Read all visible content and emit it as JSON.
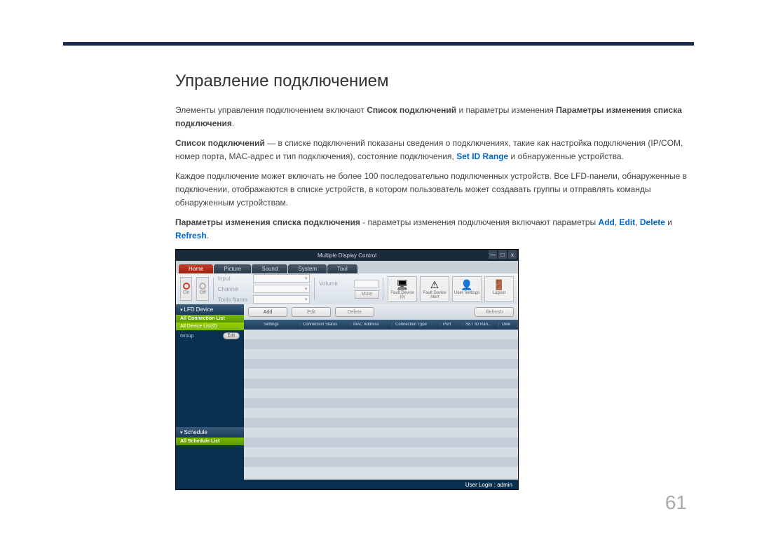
{
  "heading": "Управление подключением",
  "para1": {
    "t1": "Элементы управления подключением включают ",
    "b1": "Список подключений",
    "t2": " и параметры изменения ",
    "b2": "Параметры изменения списка подключения",
    "t3": "."
  },
  "para2": {
    "b1": "Список подключений",
    "t1": " — в списке подключений показаны сведения о подключениях, такие как настройка подключения (IP/COM, номер порта, MAC-адрес и тип подключения), состояние подключения, ",
    "blue1": "Set ID Range",
    "t2": " и обнаруженные устройства."
  },
  "para3": "Каждое подключение может включать не более 100 последовательно подключенных устройств. Все LFD-панели, обнаруженные в подключении, отображаются в списке устройств, в котором пользователь может создавать группы и отправлять команды обнаруженным устройствам.",
  "para4": {
    "b1": "Параметры изменения списка подключения",
    "t1": " - параметры изменения подключения включают параметры ",
    "a1": "Add",
    "c1": ", ",
    "a2": "Edit",
    "c2": ", ",
    "a3": "Delete",
    "c3": " и ",
    "a4": "Refresh",
    "t2": "."
  },
  "app": {
    "title": "Multiple Display Control",
    "titlebar_minimize": "—",
    "titlebar_maximize": "□",
    "titlebar_close": "x",
    "tabs": [
      "Home",
      "Picture",
      "Sound",
      "System",
      "Tool"
    ],
    "power_on": "On",
    "power_off": "Off",
    "input_lbl": "Input",
    "channel_lbl": "Channel",
    "tools_lbl": "Tools Name",
    "volume_lbl": "Volume",
    "mute_btn": "Mute",
    "right_icons": [
      {
        "name": "fault-device-icon",
        "glyph": "🖥",
        "label": "Fault Device (0)"
      },
      {
        "name": "fault-alert-icon",
        "glyph": "⚠",
        "label": "Fault Device Alert"
      },
      {
        "name": "user-settings-icon",
        "glyph": "👤",
        "label": "User Settings"
      },
      {
        "name": "logout-icon",
        "glyph": "🚪",
        "label": "Logout"
      }
    ],
    "sidebar": {
      "lfd": "LFD Device",
      "all_conn": "All Connection List",
      "all_dev": "All Device List(0)",
      "group": "Group",
      "edit": "Edit",
      "schedule": "Schedule",
      "all_sched": "All Schedule List"
    },
    "grid_toolbar": {
      "add": "Add",
      "edit": "Edit",
      "delete": "Delete",
      "refresh": "Refresh"
    },
    "grid_cols": [
      "",
      "Settings",
      "Connection Status",
      "MAC Address",
      "Connection Type",
      "Port",
      "SET ID Ran...",
      "Dele"
    ],
    "status": "User Login : admin"
  },
  "page_number": "61"
}
